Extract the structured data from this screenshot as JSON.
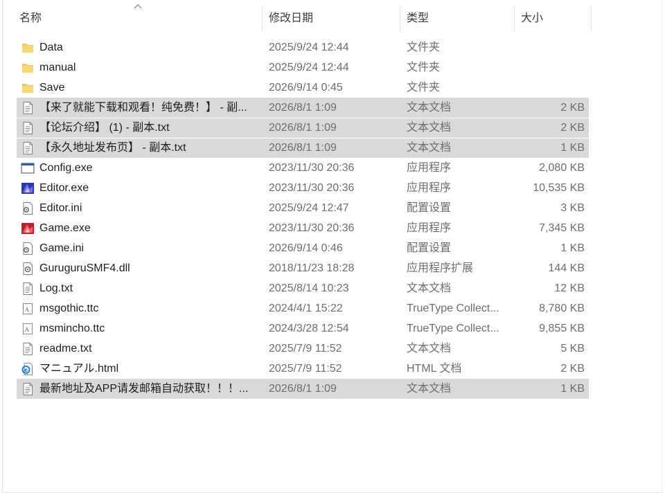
{
  "header": {
    "name": "名称",
    "date": "修改日期",
    "type": "类型",
    "size": "大小"
  },
  "files": [
    {
      "name": "Data",
      "date": "2025/9/24 12:44",
      "type": "文件夹",
      "size": "",
      "icon": "folder-icon",
      "selected": false
    },
    {
      "name": "manual",
      "date": "2025/9/24 12:44",
      "type": "文件夹",
      "size": "",
      "icon": "folder-icon",
      "selected": false
    },
    {
      "name": "Save",
      "date": "2026/9/14 0:45",
      "type": "文件夹",
      "size": "",
      "icon": "folder-icon",
      "selected": false
    },
    {
      "name": "【来了就能下载和观看！纯免费！】 - 副...",
      "date": "2026/8/1 1:09",
      "type": "文本文档",
      "size": "2 KB",
      "icon": "text-file-icon",
      "selected": true
    },
    {
      "name": "【论坛介绍】 (1) - 副本.txt",
      "date": "2026/8/1 1:09",
      "type": "文本文档",
      "size": "2 KB",
      "icon": "text-file-icon",
      "selected": true
    },
    {
      "name": "【永久地址发布页】 - 副本.txt",
      "date": "2026/8/1 1:09",
      "type": "文本文档",
      "size": "1 KB",
      "icon": "text-file-icon",
      "selected": true
    },
    {
      "name": "Config.exe",
      "date": "2023/11/30 20:36",
      "type": "应用程序",
      "size": "2,080 KB",
      "icon": "window-app-icon",
      "selected": false
    },
    {
      "name": "Editor.exe",
      "date": "2023/11/30 20:36",
      "type": "应用程序",
      "size": "10,535 KB",
      "icon": "editor-app-icon",
      "selected": false
    },
    {
      "name": "Editor.ini",
      "date": "2025/9/24 12:47",
      "type": "配置设置",
      "size": "3 KB",
      "icon": "config-file-icon",
      "selected": false
    },
    {
      "name": "Game.exe",
      "date": "2023/11/30 20:36",
      "type": "应用程序",
      "size": "7,345 KB",
      "icon": "game-app-icon",
      "selected": false
    },
    {
      "name": "Game.ini",
      "date": "2026/9/14 0:46",
      "type": "配置设置",
      "size": "1 KB",
      "icon": "config-file-icon",
      "selected": false
    },
    {
      "name": "GuruguruSMF4.dll",
      "date": "2018/11/23 18:28",
      "type": "应用程序扩展",
      "size": "144 KB",
      "icon": "dll-file-icon",
      "selected": false
    },
    {
      "name": "Log.txt",
      "date": "2025/8/14 10:23",
      "type": "文本文档",
      "size": "12 KB",
      "icon": "text-file-icon",
      "selected": false
    },
    {
      "name": "msgothic.ttc",
      "date": "2024/4/1 15:22",
      "type": "TrueType Collect...",
      "size": "8,780 KB",
      "icon": "font-file-icon",
      "selected": false
    },
    {
      "name": "msmincho.ttc",
      "date": "2024/3/28 12:54",
      "type": "TrueType Collect...",
      "size": "9,855 KB",
      "icon": "font-file-icon",
      "selected": false
    },
    {
      "name": "readme.txt",
      "date": "2025/7/9 11:52",
      "type": "文本文档",
      "size": "5 KB",
      "icon": "text-file-icon",
      "selected": false
    },
    {
      "name": "マニュアル.html",
      "date": "2025/7/9 11:52",
      "type": "HTML 文档",
      "size": "2 KB",
      "icon": "html-file-icon",
      "selected": false
    },
    {
      "name": "最新地址及APP请发邮箱自动获取！！！...",
      "date": "2026/8/1 1:09",
      "type": "文本文档",
      "size": "1 KB",
      "icon": "text-file-icon",
      "selected": true
    }
  ]
}
